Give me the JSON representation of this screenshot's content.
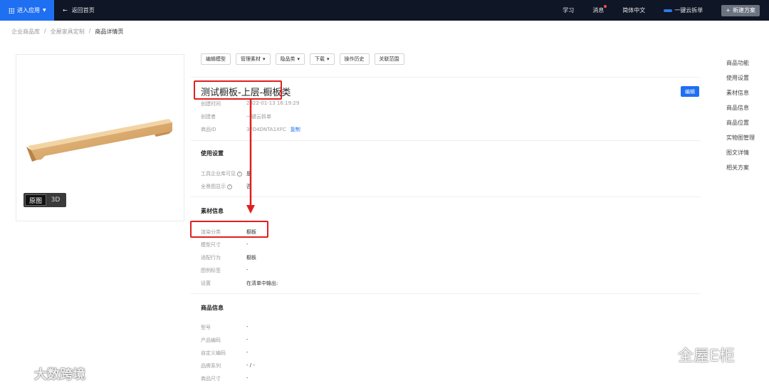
{
  "topbar": {
    "enter_app": "进入应用",
    "back_home": "返回首页",
    "learn": "学习",
    "messages": "消息",
    "language": "简体中文",
    "cloud_split": "一键云拆单",
    "new_plan": "新建方案"
  },
  "breadcrumb": [
    "企业商品库",
    "全屋家具定制",
    "商品详情页"
  ],
  "preview": {
    "mode_original": "原图",
    "mode_3d": "3D"
  },
  "toolbar": {
    "edit_model": "编辑模型",
    "manage_material": "管理素材",
    "hide": "隐品类",
    "download": "下载",
    "history": "操作历史",
    "scope": "关联范围"
  },
  "product": {
    "title": "测试橱板-上层-橱板类",
    "edit": "编辑",
    "created_time_label": "创建时间",
    "created_time": "2022-01-13 16:19:29",
    "creator_label": "创建者",
    "creator": "一键云拆单",
    "id_label": "商品ID",
    "id": "3FO4DNTA1XFC",
    "copy": "复制"
  },
  "usage": {
    "heading": "使用设置",
    "tool_visible_label": "工具企业库可见",
    "tool_visible": "是",
    "panorama_label": "全景图显示",
    "panorama": "否"
  },
  "material": {
    "heading": "素材信息",
    "render_category_label": "渲染分类",
    "render_category": "橱板",
    "model_size_label": "模型尺寸",
    "model_size": "-",
    "match_behavior_label": "适配行为",
    "match_behavior": "橱板",
    "legend_tag_label": "图例标签",
    "legend_tag": "-",
    "settings_label": "设置",
    "settings": "在清单中输出:"
  },
  "goods": {
    "heading": "商品信息",
    "model_no_label": "型号",
    "model_no": "-",
    "product_code_label": "产品编码",
    "product_code": "-",
    "custom_code_label": "自定义编码",
    "custom_code": "-",
    "brand_series_label": "品牌系列",
    "brand_series": "- / -",
    "goods_size_label": "商品尺寸",
    "goods_size": "-"
  },
  "rightnav": [
    "商品功能",
    "使用设置",
    "素材信息",
    "商品信息",
    "商品位置",
    "实物图管理",
    "图文详情",
    "相关方案"
  ],
  "watermark": {
    "left": "大数跨境",
    "right": "全屋E柜"
  },
  "colors": {
    "accent": "#1f6ff2",
    "topbar": "#0f1626",
    "highlight": "#e02020"
  }
}
